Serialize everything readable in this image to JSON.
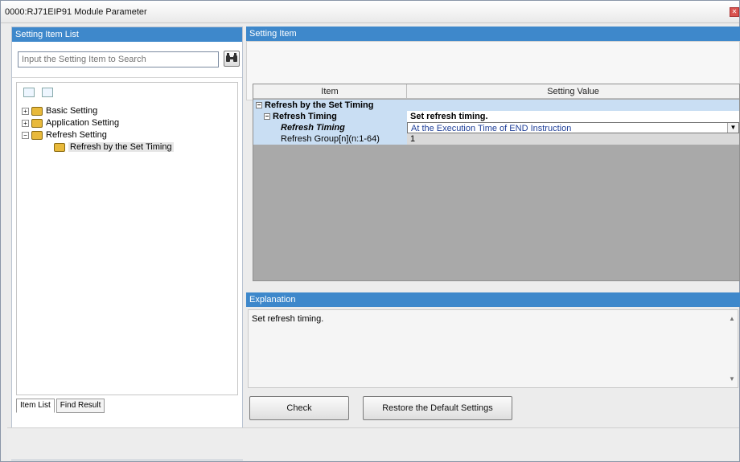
{
  "window": {
    "title": "0000:RJ71EIP91 Module Parameter",
    "close_glyph": "✕"
  },
  "left_panel": {
    "header": "Setting Item List",
    "search_placeholder": "Input the Setting Item to Search",
    "tree": [
      {
        "label": "Basic Setting",
        "toggle": "+"
      },
      {
        "label": "Application Setting",
        "toggle": "+"
      },
      {
        "label": "Refresh Setting",
        "toggle": "−"
      },
      {
        "label": "Refresh by the Set Timing"
      }
    ],
    "tabs": [
      "Item List",
      "Find Result"
    ]
  },
  "right_panel": {
    "header": "Setting Item",
    "grid": {
      "columns": [
        "Item",
        "Setting Value"
      ],
      "rows": [
        {
          "item": "Refresh by the Set Timing",
          "value": ""
        },
        {
          "item": "Refresh Timing",
          "value": "Set refresh timing."
        },
        {
          "item": "Refresh Timing",
          "value": "At the Execution Time of END Instruction"
        },
        {
          "item": "Refresh Group[n](n:1-64)",
          "value": "1"
        }
      ]
    },
    "explanation_header": "Explanation",
    "explanation_text": "Set refresh timing.",
    "buttons": {
      "check": "Check",
      "restore": "Restore the Default Settings"
    }
  },
  "colors": {
    "header_blue": "#3e88cb",
    "selected_row": "#c9def3",
    "grid_bg": "#a9a9a9"
  },
  "icons": [
    "binoculars-icon",
    "expand-all-icon",
    "collapse-all-icon",
    "folder-icon",
    "dropdown-arrow-icon"
  ]
}
